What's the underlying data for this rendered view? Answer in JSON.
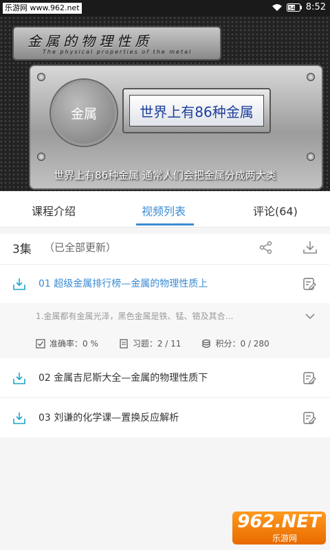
{
  "status_bar": {
    "watermark": "乐游网 www.962.net",
    "time": "8:52",
    "battery": "54"
  },
  "video": {
    "title": "金属的物理性质",
    "subtitle_en": "The physical properties of the metal",
    "circle_label": "金属",
    "main_label": "世界上有86种金属",
    "caption": "世界上有86种金属 通常人们会把金属分成两大类"
  },
  "tabs": [
    {
      "label": "课程介绍"
    },
    {
      "label": "视频列表"
    },
    {
      "label": "评论(64)"
    }
  ],
  "playlist": {
    "count": "3集",
    "status": "（已全部更新）",
    "episodes": [
      {
        "title": "01  超级金属排行榜—金属的物理性质上"
      },
      {
        "title": "02  金属吉尼斯大全—金属的物理性质下"
      },
      {
        "title": "03  刘谦的化学课—置换反应解析"
      }
    ],
    "detail": {
      "description": "1.金属都有金属光泽，黑色金属是铁、锰、铬及其合…",
      "accuracy": "准确率：0 %",
      "exercises": "习题：2 / 11",
      "points": "积分：0 / 280"
    }
  },
  "watermark_logo": {
    "text": "962.NET",
    "sub": "乐游网"
  },
  "colors": {
    "accent": "#3a8bd3",
    "icon_teal": "#1aa5c9"
  }
}
